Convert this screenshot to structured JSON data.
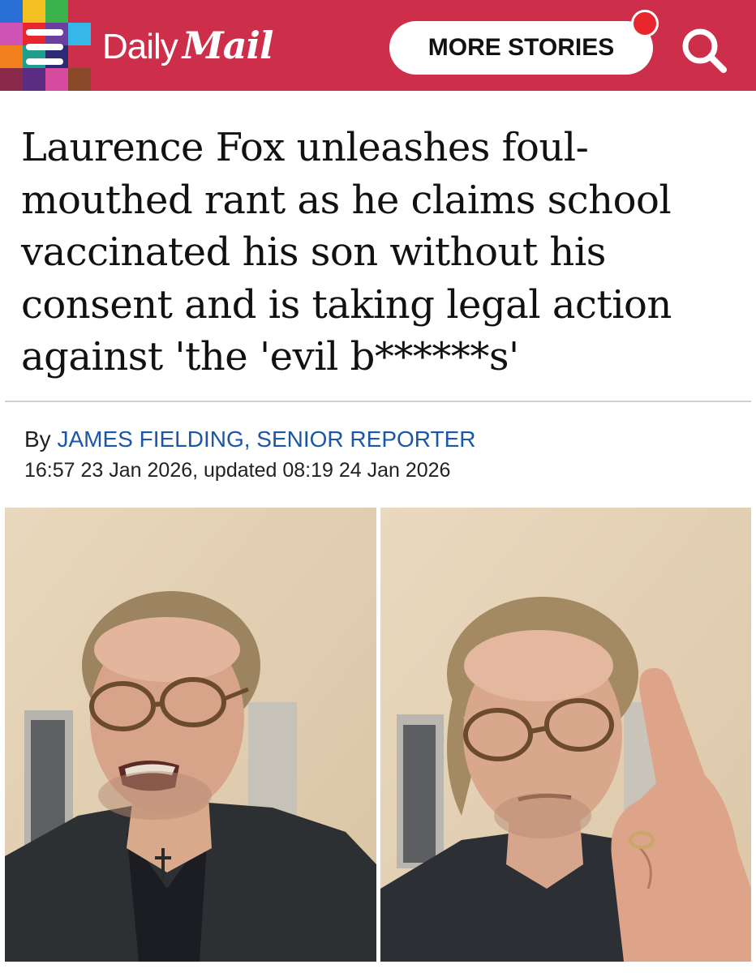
{
  "header": {
    "brand_daily": "Daily",
    "brand_mail": "Mail",
    "more_stories_label": "MORE STORIES",
    "brand_color": "#cd2e49",
    "icons": [
      "menu-icon",
      "search-icon",
      "notification-dot-icon"
    ]
  },
  "article": {
    "headline": "Laurence Fox unleashes foul-mouthed rant as he claims school vaccinated his son without his consent and is taking legal action against 'the 'evil b******s'",
    "byline_prefix": "By",
    "author": "JAMES FIELDING, SENIOR REPORTER",
    "dateline": "16:57 23 Jan 2026, updated 08:19 24 Jan 2026",
    "author_color": "#1b57a6"
  }
}
